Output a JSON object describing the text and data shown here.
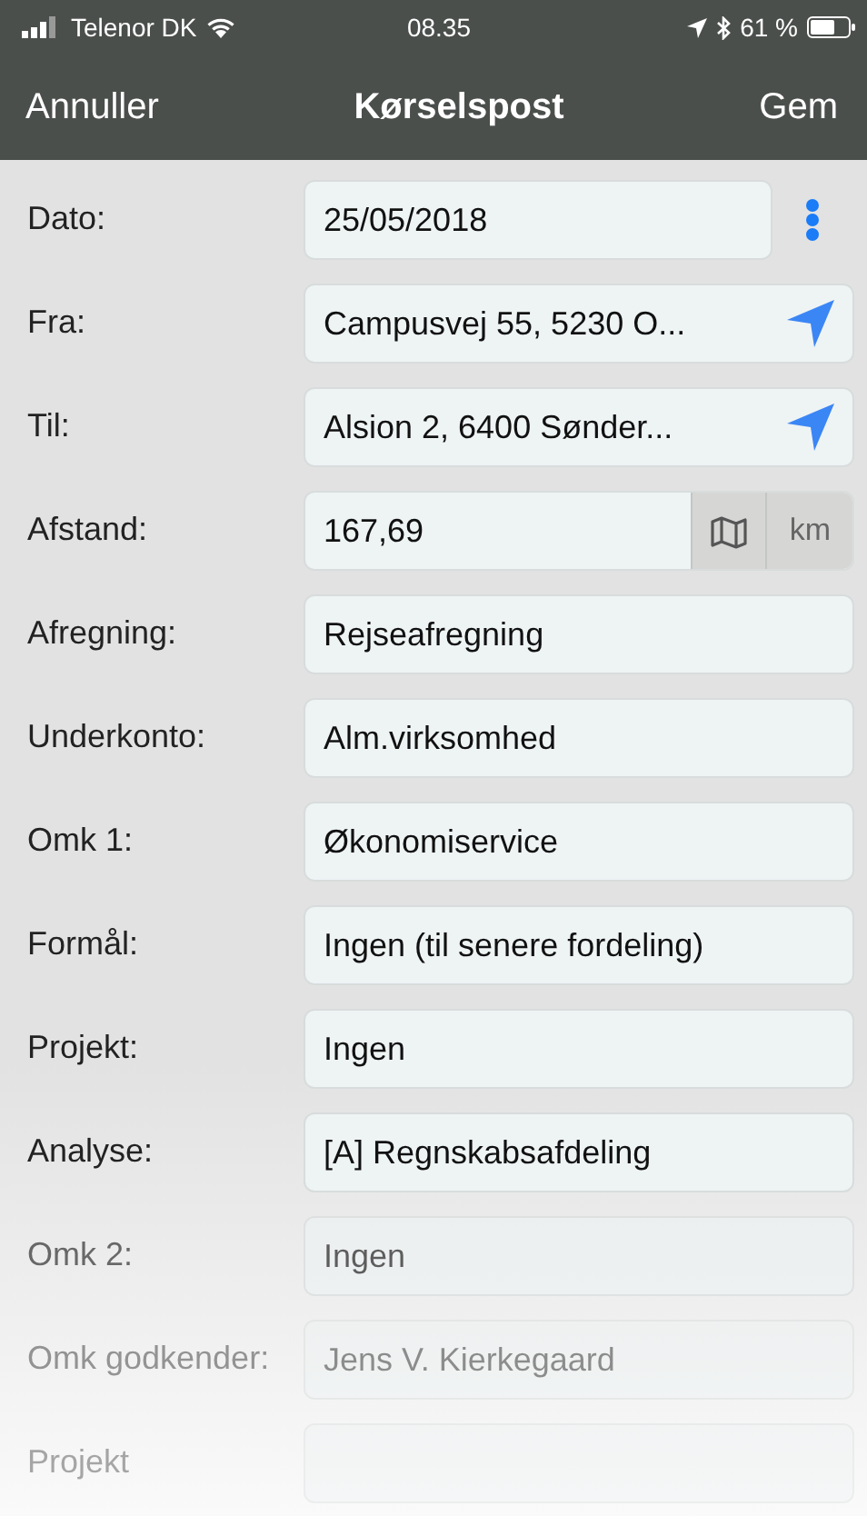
{
  "status_bar": {
    "carrier": "Telenor DK",
    "time": "08.35",
    "battery": "61 %"
  },
  "nav_bar": {
    "cancel": "Annuller",
    "title": "Kørselspost",
    "save": "Gem"
  },
  "rows": [
    {
      "label": "Dato:",
      "value": "25/05/2018",
      "kind": "menu"
    },
    {
      "label": "Fra:",
      "value": "Campusvej 55, 5230 O...",
      "kind": "locate"
    },
    {
      "label": "Til:",
      "value": "Alsion 2, 6400 Sønder...",
      "kind": "locate"
    },
    {
      "label": "Afstand:",
      "value": "167,69",
      "kind": "distance",
      "unit": "km"
    },
    {
      "label": "Afregning:",
      "value": "Rejseafregning",
      "kind": "plain"
    },
    {
      "label": "Underkonto:",
      "value": "Alm.virksomhed",
      "kind": "plain"
    },
    {
      "label": "Omk 1:",
      "value": "Økonomiservice",
      "kind": "plain"
    },
    {
      "label": "Formål:",
      "value": "Ingen (til senere fordeling)",
      "kind": "plain"
    },
    {
      "label": "Projekt:",
      "value": "Ingen",
      "kind": "plain"
    },
    {
      "label": "Analyse:",
      "value": "[A] Regnskabsafdeling",
      "kind": "plain"
    },
    {
      "label": "Omk 2:",
      "value": "Ingen",
      "kind": "plain"
    },
    {
      "label": "Omk godkender:",
      "value": "Jens V. Kierkegaard",
      "kind": "plain"
    },
    {
      "label": "Projekt",
      "kind": "plain"
    }
  ]
}
